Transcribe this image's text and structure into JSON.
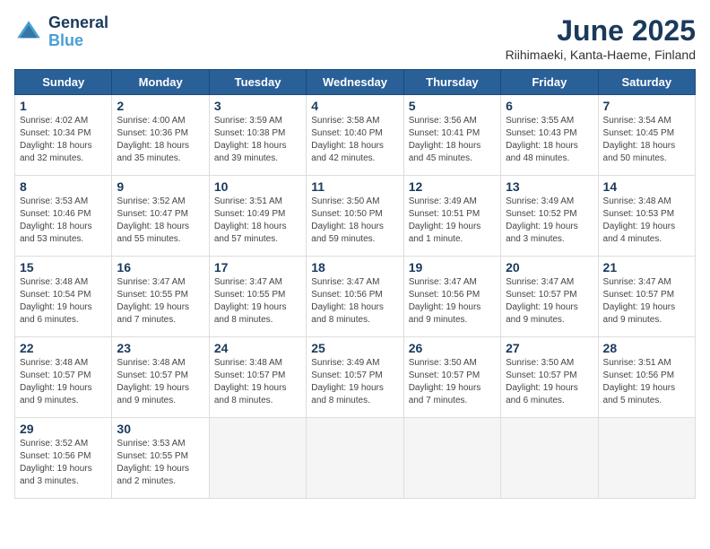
{
  "logo": {
    "line1": "General",
    "line2": "Blue"
  },
  "title": "June 2025",
  "subtitle": "Riihimaeki, Kanta-Haeme, Finland",
  "headers": [
    "Sunday",
    "Monday",
    "Tuesday",
    "Wednesday",
    "Thursday",
    "Friday",
    "Saturday"
  ],
  "weeks": [
    [
      {
        "day": "1",
        "info": "Sunrise: 4:02 AM\nSunset: 10:34 PM\nDaylight: 18 hours\nand 32 minutes."
      },
      {
        "day": "2",
        "info": "Sunrise: 4:00 AM\nSunset: 10:36 PM\nDaylight: 18 hours\nand 35 minutes."
      },
      {
        "day": "3",
        "info": "Sunrise: 3:59 AM\nSunset: 10:38 PM\nDaylight: 18 hours\nand 39 minutes."
      },
      {
        "day": "4",
        "info": "Sunrise: 3:58 AM\nSunset: 10:40 PM\nDaylight: 18 hours\nand 42 minutes."
      },
      {
        "day": "5",
        "info": "Sunrise: 3:56 AM\nSunset: 10:41 PM\nDaylight: 18 hours\nand 45 minutes."
      },
      {
        "day": "6",
        "info": "Sunrise: 3:55 AM\nSunset: 10:43 PM\nDaylight: 18 hours\nand 48 minutes."
      },
      {
        "day": "7",
        "info": "Sunrise: 3:54 AM\nSunset: 10:45 PM\nDaylight: 18 hours\nand 50 minutes."
      }
    ],
    [
      {
        "day": "8",
        "info": "Sunrise: 3:53 AM\nSunset: 10:46 PM\nDaylight: 18 hours\nand 53 minutes."
      },
      {
        "day": "9",
        "info": "Sunrise: 3:52 AM\nSunset: 10:47 PM\nDaylight: 18 hours\nand 55 minutes."
      },
      {
        "day": "10",
        "info": "Sunrise: 3:51 AM\nSunset: 10:49 PM\nDaylight: 18 hours\nand 57 minutes."
      },
      {
        "day": "11",
        "info": "Sunrise: 3:50 AM\nSunset: 10:50 PM\nDaylight: 18 hours\nand 59 minutes."
      },
      {
        "day": "12",
        "info": "Sunrise: 3:49 AM\nSunset: 10:51 PM\nDaylight: 19 hours\nand 1 minute."
      },
      {
        "day": "13",
        "info": "Sunrise: 3:49 AM\nSunset: 10:52 PM\nDaylight: 19 hours\nand 3 minutes."
      },
      {
        "day": "14",
        "info": "Sunrise: 3:48 AM\nSunset: 10:53 PM\nDaylight: 19 hours\nand 4 minutes."
      }
    ],
    [
      {
        "day": "15",
        "info": "Sunrise: 3:48 AM\nSunset: 10:54 PM\nDaylight: 19 hours\nand 6 minutes."
      },
      {
        "day": "16",
        "info": "Sunrise: 3:47 AM\nSunset: 10:55 PM\nDaylight: 19 hours\nand 7 minutes."
      },
      {
        "day": "17",
        "info": "Sunrise: 3:47 AM\nSunset: 10:55 PM\nDaylight: 19 hours\nand 8 minutes."
      },
      {
        "day": "18",
        "info": "Sunrise: 3:47 AM\nSunset: 10:56 PM\nDaylight: 18 hours\nand 8 minutes."
      },
      {
        "day": "19",
        "info": "Sunrise: 3:47 AM\nSunset: 10:56 PM\nDaylight: 19 hours\nand 9 minutes."
      },
      {
        "day": "20",
        "info": "Sunrise: 3:47 AM\nSunset: 10:57 PM\nDaylight: 19 hours\nand 9 minutes."
      },
      {
        "day": "21",
        "info": "Sunrise: 3:47 AM\nSunset: 10:57 PM\nDaylight: 19 hours\nand 9 minutes."
      }
    ],
    [
      {
        "day": "22",
        "info": "Sunrise: 3:48 AM\nSunset: 10:57 PM\nDaylight: 19 hours\nand 9 minutes."
      },
      {
        "day": "23",
        "info": "Sunrise: 3:48 AM\nSunset: 10:57 PM\nDaylight: 19 hours\nand 9 minutes."
      },
      {
        "day": "24",
        "info": "Sunrise: 3:48 AM\nSunset: 10:57 PM\nDaylight: 19 hours\nand 8 minutes."
      },
      {
        "day": "25",
        "info": "Sunrise: 3:49 AM\nSunset: 10:57 PM\nDaylight: 19 hours\nand 8 minutes."
      },
      {
        "day": "26",
        "info": "Sunrise: 3:50 AM\nSunset: 10:57 PM\nDaylight: 19 hours\nand 7 minutes."
      },
      {
        "day": "27",
        "info": "Sunrise: 3:50 AM\nSunset: 10:57 PM\nDaylight: 19 hours\nand 6 minutes."
      },
      {
        "day": "28",
        "info": "Sunrise: 3:51 AM\nSunset: 10:56 PM\nDaylight: 19 hours\nand 5 minutes."
      }
    ],
    [
      {
        "day": "29",
        "info": "Sunrise: 3:52 AM\nSunset: 10:56 PM\nDaylight: 19 hours\nand 3 minutes."
      },
      {
        "day": "30",
        "info": "Sunrise: 3:53 AM\nSunset: 10:55 PM\nDaylight: 19 hours\nand 2 minutes."
      },
      {
        "day": "",
        "info": ""
      },
      {
        "day": "",
        "info": ""
      },
      {
        "day": "",
        "info": ""
      },
      {
        "day": "",
        "info": ""
      },
      {
        "day": "",
        "info": ""
      }
    ]
  ]
}
